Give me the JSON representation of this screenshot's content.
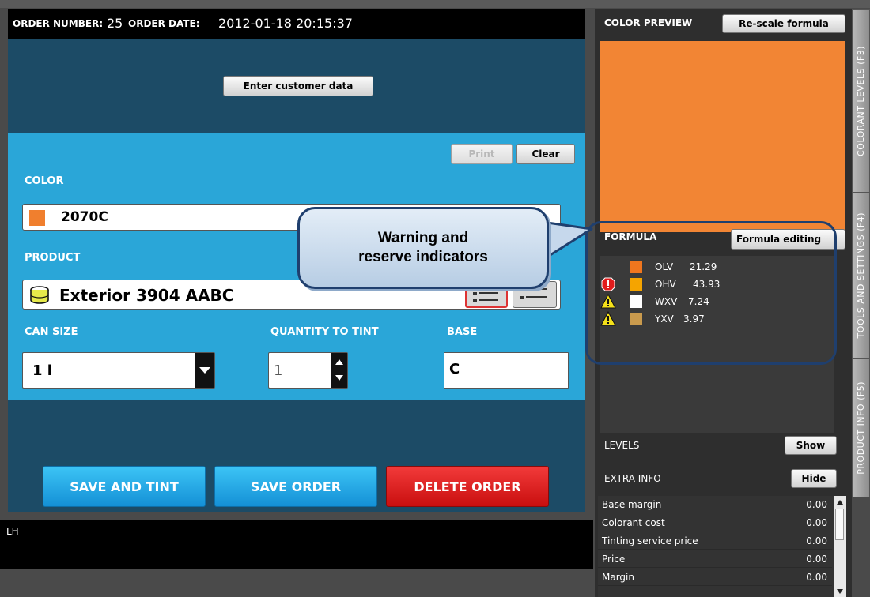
{
  "header": {
    "order_number_label": "ORDER NUMBER:",
    "order_number": "25",
    "order_date_label": "ORDER DATE:",
    "order_date": "2012-01-18 20:15:37"
  },
  "buttons": {
    "customer_data": "Enter customer data",
    "print": "Print",
    "clear": "Clear",
    "save_and_tint": "SAVE AND TINT",
    "save_order": "SAVE ORDER",
    "delete_order": "DELETE ORDER"
  },
  "color": {
    "label": "COLOR",
    "value": "2070C",
    "swatch": "#f07f2e"
  },
  "product": {
    "label": "PRODUCT",
    "value": "Exterior 3904 AABC",
    "icon": "paint-can-icon"
  },
  "can_size": {
    "label": "CAN SIZE",
    "value": "1 l"
  },
  "quantity": {
    "label": "QUANTITY TO TINT",
    "value": "1"
  },
  "base": {
    "label": "BASE",
    "value": "C"
  },
  "status_bar": {
    "text": "LH"
  },
  "preview": {
    "label": "COLOR PREVIEW",
    "rescale_button": "Re-scale formula",
    "color": "#f28534"
  },
  "formula": {
    "label": "FORMULA",
    "edit_button": "Formula editing",
    "rows": [
      {
        "code": "OLV",
        "amount": "21.29",
        "color": "#f0761e",
        "warning": ""
      },
      {
        "code": "OHV",
        "amount": "43.93",
        "color": "#f5a400",
        "warning": "reserve-icon"
      },
      {
        "code": "WXV",
        "amount": "7.24",
        "color": "#ffffff",
        "warning": "warning-icon"
      },
      {
        "code": "YXV",
        "amount": "3.97",
        "color": "#c99a4d",
        "warning": "warning-icon"
      }
    ]
  },
  "levels": {
    "label": "LEVELS",
    "button": "Show"
  },
  "extra_info": {
    "label": "EXTRA INFO",
    "button": "Hide",
    "rows": [
      {
        "label": "Base margin",
        "value": "0.00"
      },
      {
        "label": "Colorant cost",
        "value": "0.00"
      },
      {
        "label": "Tinting service price",
        "value": "0.00"
      },
      {
        "label": "Price",
        "value": "0.00"
      },
      {
        "label": "Margin",
        "value": "0.00"
      }
    ]
  },
  "tabs": {
    "colorant_levels": "COLORANT LEVELS (F3)",
    "tools_settings": "TOOLS AND SETTINGS (F4)",
    "product_info": "PRODUCT INFO (F5)"
  },
  "callout": {
    "line1": "Warning and",
    "line2": "reserve indicators"
  }
}
